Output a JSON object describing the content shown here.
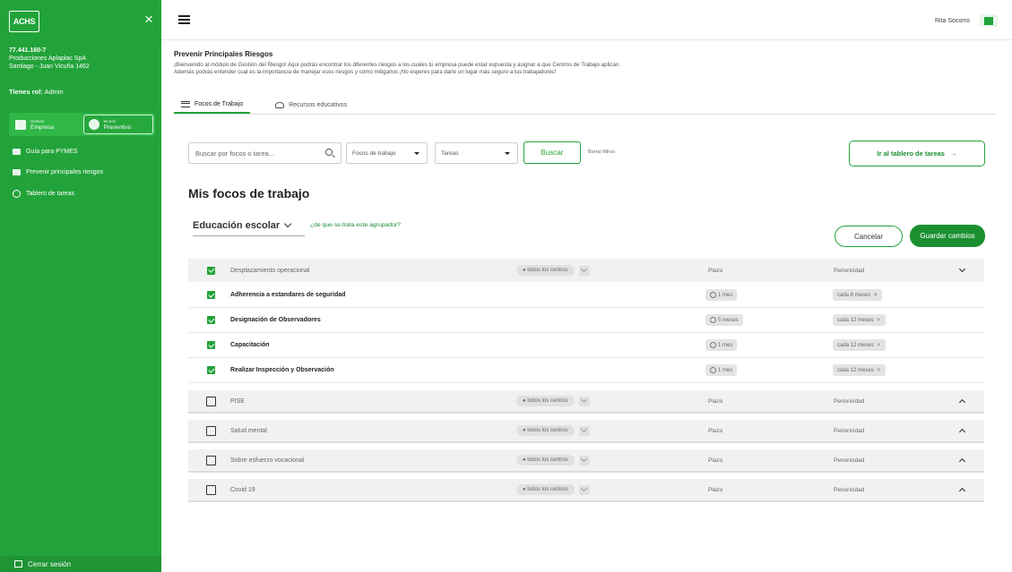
{
  "sidebar": {
    "logo": "ACHS",
    "company_id": "77.441.160-7",
    "company_name": "Producciones Aplaplac SpA",
    "company_address": "Santiago - Juan Vicuña 1462",
    "role_prefix": "Tienes rol:",
    "role_value": "Admin",
    "toggle": [
      {
        "small": "Gestión",
        "label": "Empresa"
      },
      {
        "small": "Mundo",
        "label": "Preventivo"
      }
    ],
    "items": [
      {
        "label": "Guía para PYMES"
      },
      {
        "label": "Prevenir principales riesgos"
      },
      {
        "label": "Tablero de tareas"
      }
    ],
    "logout": "Cerrar sesión",
    "brand_color": "#22a33a"
  },
  "topbar": {
    "user_name": "Rita Socorro"
  },
  "page": {
    "title": "Prevenir Principales Riesgos",
    "intro": "¡Bienvenido al módulo de Gestión del Riesgo! Aquí podrás encontrar los diferentes riesgos a los cuales tu empresa puede estar expuesta y asignar a que Centros de Trabajo aplican. Además podrás entender cual es la importancia de manejar esos riesgos y cómo mitigarlos ¡No esperes para darle un lugar más seguro a tus trabajadores!",
    "tabs": [
      {
        "label": "Focos de Trabajo",
        "active": true
      },
      {
        "label": "Recursos educativos",
        "active": false
      }
    ]
  },
  "filters": {
    "search_placeholder": "Buscar por focos o tarea...",
    "focos_select": "Focos de trabajo",
    "tareas_select": "Tareas",
    "search_button": "Buscar",
    "clear_filters": "Borrar filtros",
    "board_button": "Ir al tablero de tareas",
    "board_arrow": "→"
  },
  "section": {
    "title": "Mis focos de trabajo",
    "group": "Educación escolar",
    "group_help": "¿de que se trata este agrupador?",
    "cancel": "Cancelar",
    "save": "Guardar cambios"
  },
  "table": {
    "centers_label": "todos los centros",
    "plazo_label": "Plazo",
    "perio_label": "Perioricidad",
    "expanded_group": {
      "name": "Desplazamiento operacional",
      "checked": true,
      "rows": [
        {
          "name": "Adherencia a estandares de seguridad",
          "plazo": "1 mes",
          "perio": "cada 8 meses"
        },
        {
          "name": "Designación de Observadores",
          "plazo": "5 meses",
          "perio": "cada 12 meses"
        },
        {
          "name": "Capacitación",
          "plazo": "1 mes",
          "perio": "cada 12 meses"
        },
        {
          "name": "Realizar Inspección y Observación",
          "plazo": "1 mes",
          "perio": "cada 12 meses"
        }
      ]
    },
    "collapsed_groups": [
      {
        "name": "PISE"
      },
      {
        "name": "Salud mental"
      },
      {
        "name": "Sobre esfuerzo vocacional"
      },
      {
        "name": "Covid 19"
      }
    ]
  }
}
